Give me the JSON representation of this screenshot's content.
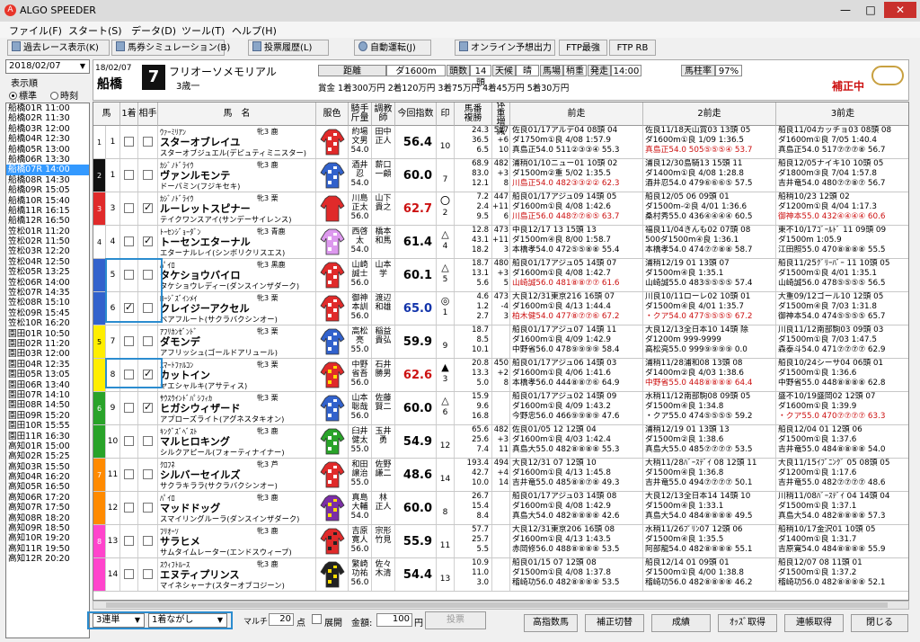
{
  "app": {
    "title": "ALGO SPEEDER",
    "logo": "A"
  },
  "menu": [
    "ファイル(F)",
    "スタート(S)",
    "データ(D)",
    "ツール(T)",
    "ヘルプ(H)"
  ],
  "toolbar": [
    "過去レース表示(K)",
    "馬券シミュレーション(B)",
    "投票履歴(L)",
    "自動運転(J)",
    "オンライン予想出力",
    "FTP最強",
    "FTP RB"
  ],
  "left": {
    "date": "2018/02/07",
    "order_label": "表示順",
    "order_options": [
      "標準",
      "時刻"
    ],
    "races": [
      "船橋01R 11:00",
      "船橋02R 11:30",
      "船橋03R 12:00",
      "船橋04R 12:30",
      "船橋05R 13:00",
      "船橋06R 13:30",
      "船橋07R 14:00",
      "船橋08R 14:30",
      "船橋09R 15:05",
      "船橋10R 15:40",
      "船橋11R 16:15",
      "船橋12R 16:50",
      "笠松01R 11:20",
      "笠松02R 11:50",
      "笠松03R 12:20",
      "笠松04R 12:50",
      "笠松05R 13:25",
      "笠松06R 14:00",
      "笠松07R 14:35",
      "笠松08R 15:10",
      "笠松09R 15:45",
      "笠松10R 16:20",
      "園田01R 10:50",
      "園田02R 11:20",
      "園田03R 12:00",
      "園田04R 12:35",
      "園田05R 13:05",
      "園田06R 13:40",
      "園田07R 14:10",
      "園田08R 14:50",
      "園田09R 15:20",
      "園田10R 15:55",
      "園田11R 16:30",
      "高知01R 15:00",
      "高知02R 15:25",
      "高知03R 15:50",
      "高知04R 16:20",
      "高知05R 16:50",
      "高知06R 17:20",
      "高知07R 17:50",
      "高知08R 18:20",
      "高知09R 18:50",
      "高知10R 19:20",
      "高知11R 19:50",
      "高知12R 20:20"
    ],
    "selected": 6
  },
  "race": {
    "date": "18/02/07",
    "venue": "船橋",
    "number": "7",
    "name": "フリオーソメモリアル",
    "cond": "3歳一",
    "labels": {
      "dist": "距離",
      "heads": "頭数",
      "weather": "天候",
      "track": "馬場",
      "start": "発走",
      "rate": "馬柱率"
    },
    "dist": "ダ1600m",
    "heads": "14頭",
    "weather": "晴",
    "track": "稍重",
    "start": "14:00",
    "rate": "97%",
    "prize": "賞金 1着300万円 2着120万円 3着75万円 4着45万円 5着30万円",
    "hosei": "補正中"
  },
  "columns": [
    "馬",
    "1着",
    "相手",
    "馬　名",
    "服色",
    "騎手\n斤量",
    "調教\n師",
    "今回指数",
    "印",
    "馬番\n複勝",
    "馬体重\n増減",
    "前走",
    "2前走",
    "3前走"
  ],
  "horses": [
    {
      "waku": "1",
      "wc": "#ffffff",
      "wt": "#000",
      "num": "1",
      "sire": "ｳｧｰﾐﾘｱﾝ",
      "sex": "牝3 鹿",
      "name": "スターオブレイユ",
      "ped": "スターオブジュエル(デピュティミニスター)",
      "silk": [
        "#e02a2a",
        "#ffffff"
      ],
      "j": [
        "約場",
        "文男",
        "54.0"
      ],
      "t": [
        "田中",
        "正人"
      ],
      "idx": "56.4",
      "ic": "",
      "mark": "",
      "m2": "10",
      "rank": [
        "24.3",
        "36.5",
        "6.5"
      ],
      "w": [
        "517",
        "+6",
        "10"
      ],
      "p1": [
        "佐良01/17アルデ04 08頭 04",
        "ダ1750m①良 4/08 1:57.9",
        "真島正54.0 511②③③④ 55.3"
      ],
      "p2": [
        "佐良11/18天山賞03 13頭 05",
        "ダ1600m①良 1/09 1:36.5",
        "真島正54.0 505⑤⑤⑤④ 53.7"
      ],
      "p3": [
        "船良11/04カッチョ03 08頭 08",
        "ダ1600m①良 7/05 1:40.4",
        "真島正54.0 517⑦⑦⑦⑧ 56.7"
      ],
      "r": [
        0,
        1,
        0
      ]
    },
    {
      "waku": "2",
      "wc": "#111111",
      "wt": "#fff",
      "num": "1",
      "sire": "ｶｼﾞﾉﾄﾞﾗｲｳ",
      "sex": "牝3 鹿",
      "name": "ヴァンルモンテ",
      "ped": "ドーバミン(フジキセキ)",
      "silk": [
        "#3262cc",
        "#ffffff"
      ],
      "j": [
        "酒井",
        "忍",
        "54.0"
      ],
      "t": [
        "薪口",
        "一顧"
      ],
      "idx": "60.0",
      "ic": "",
      "mark": "",
      "m2": "7",
      "rank": [
        "68.9",
        "83.0",
        "12.1"
      ],
      "w": [
        "482",
        "+3",
        "8"
      ],
      "p1": [
        "浦稍01/10ニュー01 10頭 02",
        "ダ1500m②重 5/02 1:35.5",
        "川島正54.0 482③③②② 62.3"
      ],
      "p2": [
        "浦良12/30島騎13 15頭 11",
        "ダ1400m①良 4/08 1:28.8",
        "酒井忍54.0 479⑥⑥⑥⑤ 57.5"
      ],
      "p3": [
        "船良12/05ナイキ10 10頭 05",
        "ダ1800m③良 7/04 1:57.8",
        "吉井竜54.0 480⑦⑦⑧⑦ 56.7"
      ],
      "r": [
        1,
        0,
        0
      ]
    },
    {
      "waku": "3",
      "wc": "#e02a2a",
      "wt": "#fff",
      "num": "3",
      "sire": "ｶｼﾞﾉﾄﾞﾗｲｳ",
      "sex": "牝3 栗",
      "name": "ルーレットスピナー",
      "ped": "テイクワンスアイ(サンデーサイレンス)",
      "silk": [
        "#e02a2a",
        "#e02a2a"
      ],
      "j": [
        "川島",
        "正太",
        "56.0"
      ],
      "t": [
        "山下",
        "貴之"
      ],
      "idx": "62.7",
      "ic": "red",
      "mark": "〇",
      "m2": "2",
      "rank": [
        "7.2",
        "2.4",
        "9.5"
      ],
      "w": [
        "447",
        "+11",
        "6"
      ],
      "p1": [
        "船良01/17アジュ09 14頭 05",
        "ダ1600m①良 4/08 1:42.6",
        "川島正56.0 448⑦⑦⑥⑤ 63.7"
      ],
      "p2": [
        "船良12/05 06 09頭 01",
        "ダ1500m-②良 4/01 1:36.6",
        "桑村秀55.0 436④④④④ 60.5"
      ],
      "p3": [
        "船稍10/23 12頭 02",
        "ダ1200m①良 4/04 1:17.3",
        "御神本55.0 432④④④④ 60.6"
      ],
      "r": [
        1,
        0,
        1
      ]
    },
    {
      "waku": "4",
      "wc": "#ffffff",
      "wt": "#000",
      "num": "4",
      "sire": "ﾄｰｾﾝｼﾞｮｰﾀﾞﾝ",
      "sex": "牝3 青鹿",
      "name": "トーセンエターナル",
      "ped": "エターナルレイ(シンボリクリスエス)",
      "silk": [
        "#dd99ee",
        "#ffffff"
      ],
      "j": [
        "西啓",
        "太",
        "54.0"
      ],
      "t": [
        "橋本",
        "和馬"
      ],
      "idx": "61.4",
      "ic": "",
      "mark": "△",
      "m2": "4",
      "rank": [
        "12.8",
        "43.1",
        "18.2"
      ],
      "w": [
        "473",
        "+11",
        "3"
      ],
      "p1": [
        "中良12/17 13 15頭 13",
        "ダ1500m④良 8/00 1:58.7",
        "本橋孝54.0 472⑤⑤⑧⑧ 55.4"
      ],
      "p2": [
        "福良11/04きんも02 07頭 08",
        "500ダ1500m④良 1:36.1",
        "本橋孝54.0 474⑦⑦⑧⑧ 58.7"
      ],
      "p3": [
        "東不10/17ｺﾞｰﾙﾄﾞ 11 09頭 09",
        "ダ1500m 1:05.9",
        "江田照55.0 470⑧⑧⑧⑧ 55.5"
      ],
      "r": [
        0,
        0,
        0
      ]
    },
    {
      "waku": "4",
      "wc": "#3262cc",
      "wt": "#fff",
      "num": "5",
      "sire": "ﾊﾟｲﾛ",
      "sex": "牝3 黒鹿",
      "name": "タケショウバイロ",
      "ped": "タケショウレディー(ダンスインザダーク)",
      "silk": [
        "#e02a2a",
        "#ffffff"
      ],
      "j": [
        "山崎",
        "誠士",
        "56.0"
      ],
      "t": [
        "山本",
        "学"
      ],
      "idx": "60.1",
      "ic": "",
      "mark": "△",
      "m2": "5",
      "rank": [
        "18.7",
        "13.1",
        "5.6"
      ],
      "w": [
        "480",
        "+3",
        "5"
      ],
      "p1": [
        "船良01/17アジュ05 14頭 07",
        "ダ1600m①良 4/08 1:42.7",
        "山崎誠56.0 481⑧⑧⑦⑦ 61.6"
      ],
      "p2": [
        "浦稍12/19 01 13頭 07",
        "ダ1500m④良 1:35.1",
        "山崎誠55.0 483⑤⑤⑤⑤ 57.4"
      ],
      "p3": [
        "船良11/25ｸﾞﾘｰﾊﾞｰ 11 10頭 05",
        "ダ1500m①良 4/01 1:35.1",
        "山崎誠56.0 478⑤⑤⑤⑤ 56.5"
      ],
      "r": [
        1,
        0,
        0
      ]
    },
    {
      "waku": "4",
      "wc": "#3262cc",
      "wt": "#fff",
      "num": "6",
      "sire": "ﾛｰｼﾞｽﾞｲﾝﾒｲ",
      "sex": "牝3 栗",
      "name": "クレイジーアクセル",
      "ped": "ベアフルート(サクラバクシンオー)",
      "silk": [
        "#e02a2a",
        "#ffffff"
      ],
      "j": [
        "御神",
        "本訓",
        "56.0"
      ],
      "t": [
        "渡辺",
        "和雄"
      ],
      "idx": "65.0",
      "ic": "blue",
      "mark": "◎",
      "m2": "1",
      "rank": [
        "4.6",
        "1.2",
        "2.7"
      ],
      "w": [
        "473",
        "-4",
        "3"
      ],
      "p1": [
        "大良12/31東京216 16頭 07",
        "ダ1600m①良 4/13 1:44.4",
        "柏木健54.0 477⑧⑦⑦⑥ 67.2"
      ],
      "p2": [
        "川良10/11ローレ02 10頭 01",
        "ダ1500m④良 4/01 1:35.7",
        "・クア54.0 477⑤⑤⑤⑤ 67.2"
      ],
      "p3": [
        "大重09/12ゴール10 12頭 05",
        "ダ1500m④良 7/03 1:31.8",
        "御神本54.0 474⑤⑤⑤⑤ 65.7"
      ],
      "r": [
        1,
        1,
        0
      ]
    },
    {
      "waku": "5",
      "wc": "#ffee00",
      "wt": "#000",
      "num": "7",
      "sire": "ｱﾌﾘｶﾝｾﾞﾝﾄﾞ",
      "sex": "牝3 栗",
      "name": "ダモンデ",
      "ped": "アフリッシュ(ゴールドアリュール)",
      "silk": [
        "#3262cc",
        "#ffffff"
      ],
      "j": [
        "高松",
        "亮",
        "55.0"
      ],
      "t": [
        "稲益",
        "貴弘"
      ],
      "idx": "59.9",
      "ic": "",
      "mark": "",
      "m2": "9",
      "rank": [
        "18.7",
        "8.5",
        "10.1"
      ],
      "w": [
        "",
        "",
        ""
      ],
      "p1": [
        "船良01/17アジュ07 14頭 11",
        "ダ1600m①良 4/09 1:42.9",
        "中野省56.0 478⑨⑨⑨⑨ 58.4"
      ],
      "p2": [
        "大良12/13全日本10 14頭 除",
        "ダ1200m 999-9999",
        "高松亮55.0 999⑨⑨⑨⑨ 0.0"
      ],
      "p3": [
        "川良11/12南部駒03 09頭 03",
        "ダ1500m①良 7/03 1:47.5",
        "森泰斗54.0 471⑦⑦⑦⑦ 62.9"
      ],
      "r": [
        0,
        0,
        0
      ]
    },
    {
      "waku": "5",
      "wc": "#ffee00",
      "wt": "#000",
      "num": "8",
      "sire": "ｽﾏｰﾄﾌｧﾙｺﾝ",
      "sex": "牝3 栗",
      "name": "カットイン",
      "ped": "ヤエシャルキ(アサティス)",
      "silk": [
        "#e02a2a",
        "#ffdd00"
      ],
      "j": [
        "中野",
        "省吾",
        "56.0"
      ],
      "t": [
        "石井",
        "勝男"
      ],
      "idx": "62.6",
      "ic": "red",
      "mark": "▲",
      "m2": "3",
      "rank": [
        "20.8",
        "13.3",
        "5.0"
      ],
      "w": [
        "450",
        "+2",
        "8"
      ],
      "p1": [
        "船良01/17アジュ06 14頭 03",
        "ダ1600m①良 4/06 1:41.6",
        "本橋孝56.0 444⑧⑧⑦⑥ 64.9"
      ],
      "p2": [
        "浦稍11/28浦和08 13頭 08",
        "ダ1400m②良 4/03 1:38.6",
        "中野省55.0 448⑧⑧⑧⑧ 64.4"
      ],
      "p3": [
        "船良10/24シーサ04 06頭 01",
        "ダ1500m①良 1:36.6",
        "中野省55.0 448⑧⑧⑧⑧ 62.8"
      ],
      "r": [
        0,
        1,
        0
      ]
    },
    {
      "waku": "6",
      "wc": "#29a329",
      "wt": "#fff",
      "num": "9",
      "sire": "ｻｳｽｳｲﾝﾄﾞﾊﾟｼﾌｨｶ",
      "sex": "牝3 栗",
      "name": "ヒガシウィザード",
      "ped": "アプローズライト(アグネスタキオン)",
      "silk": [
        "#3262cc",
        "#ffffff"
      ],
      "j": [
        "山本",
        "聡哉",
        "56.0"
      ],
      "t": [
        "佐藤",
        "賢二"
      ],
      "idx": "60.0",
      "ic": "",
      "mark": "△",
      "m2": "6",
      "rank": [
        "15.9",
        "9.6",
        "16.8"
      ],
      "w": [
        "",
        "",
        ""
      ],
      "p1": [
        "船良01/17アジュ02 14頭 09",
        "ダ1600m①良 4/09 1:43.2",
        "今野忠56.0 466⑨⑨⑧⑨ 47.6"
      ],
      "p2": [
        "水稍11/12南部駒08 09頭 05",
        "ダ1500m④良 1:34.8",
        "・クア55.0 474⑤⑤⑤⑤ 59.2"
      ],
      "p3": [
        "盛不10/19盛岡02 12頭 07",
        "ダ1600m①良 1:39.9",
        "・クア55.0 470⑦⑦⑦⑦ 63.3"
      ],
      "r": [
        0,
        0,
        1
      ]
    },
    {
      "waku": "6",
      "wc": "#29a329",
      "wt": "#fff",
      "num": "10",
      "sire": "ｷﾝｸﾞｽﾞﾍﾞｽﾄ",
      "sex": "牝3 鹿",
      "name": "マルヒロキング",
      "ped": "シルクアピール(フォーティナイナー)",
      "silk": [
        "#29a329",
        "#ffffff"
      ],
      "j": [
        "臼井",
        "健太",
        "55.0"
      ],
      "t": [
        "玉井",
        "勇"
      ],
      "idx": "54.9",
      "ic": "",
      "mark": "",
      "m2": "12",
      "rank": [
        "65.6",
        "25.6",
        "7.4"
      ],
      "w": [
        "482",
        "+3",
        "11"
      ],
      "p1": [
        "佐良01/05 12 12頭 04",
        "ダ1600m①良 4/03 1:42.4",
        "真島大55.0 482⑧⑧⑧⑧ 55.3"
      ],
      "p2": [
        "浦稍12/19 01 13頭 13",
        "ダ1500m②良 1:38.6",
        "真島大55.0 485⑦⑦⑦⑦ 53.5"
      ],
      "p3": [
        "船良12/04 01 12頭 06",
        "ダ1500m①良 1:37.6",
        "吉井竜55.0 484⑧⑧⑧⑧ 54.0"
      ],
      "r": [
        0,
        0,
        0
      ]
    },
    {
      "waku": "7",
      "wc": "#ff8a00",
      "wt": "#fff",
      "num": "11",
      "sire": "ｸﾛﾌﾈ",
      "sex": "牝3 芦",
      "name": "シルバーセイルズ",
      "ped": "サクラキララ(サクラバクシンオー)",
      "silk": [
        "#e02a2a",
        "#ffffff"
      ],
      "j": [
        "和田",
        "譲治",
        "55.0"
      ],
      "t": [
        "佐野",
        "謙二"
      ],
      "idx": "48.6",
      "ic": "",
      "mark": "",
      "m2": "14",
      "rank": [
        "193.4",
        "42.7",
        "10.0"
      ],
      "w": [
        "494",
        "+4",
        "14"
      ],
      "p1": [
        "大良12/31 07 12頭 10",
        "ダ1600m①良 4/13 1:45.8",
        "吉井竜55.0 485⑧⑧⑦⑧ 49.3"
      ],
      "p2": [
        "大稍11/28ﾊﾞｰｽﾃﾞｲ 08 12頭 11",
        "ダ1500m④良 1:36.8",
        "吉井竜55.0 494⑦⑦⑦⑦ 50.1"
      ],
      "p3": [
        "大良11/15ｲﾌﾞﾆﾝｸﾞ 05 08頭 05",
        "ダ1200m①良 1:17.6",
        "吉井竜55.0 482⑦⑦⑦⑦ 48.6"
      ],
      "r": [
        0,
        0,
        0
      ]
    },
    {
      "waku": "7",
      "wc": "#ff8a00",
      "wt": "#fff",
      "num": "12",
      "sire": "ﾊﾟｲﾛ",
      "sex": "牝3 鹿",
      "name": "マッドドッグ",
      "ped": "スマイリングルーラ(ダンスインザダーク)",
      "silk": [
        "#7b2ea6",
        "#ffdd00"
      ],
      "j": [
        "真島",
        "大輔",
        "54.0"
      ],
      "t": [
        "林",
        "正人"
      ],
      "idx": "60.0",
      "ic": "",
      "mark": "",
      "m2": "8",
      "rank": [
        "26.7",
        "15.4",
        "8.4"
      ],
      "w": [
        "",
        "",
        ""
      ],
      "p1": [
        "船良01/17アジュ03 14頭 08",
        "ダ1600m①良 4/08 1:42.9",
        "真島大54.0 482⑧⑧⑧⑧ 42.6"
      ],
      "p2": [
        "大良12/13全日本14 14頭 10",
        "ダ1500m④良 1:33.1",
        "真島大54.0 484⑧⑧⑧⑧ 49.5"
      ],
      "p3": [
        "川稍11/08ﾊﾞｰｽﾃﾞｲ 04 14頭 04",
        "ダ1500m①良 1:37.1",
        "真島大54.0 482⑧⑧⑧⑧ 57.3"
      ],
      "r": [
        0,
        0,
        0
      ]
    },
    {
      "waku": "8",
      "wc": "#ff44cc",
      "wt": "#fff",
      "num": "13",
      "sire": "ﾌﾘｵｰｿ",
      "sex": "牝3 鹿",
      "name": "サラヒメ",
      "ped": "サムタイムレーター(エンドスウィープ)",
      "silk": [
        "#e02a2a",
        "#222222"
      ],
      "j": [
        "吉原",
        "寛人",
        "56.0"
      ],
      "t": [
        "宗形",
        "竹見"
      ],
      "idx": "55.9",
      "ic": "",
      "mark": "",
      "m2": "11",
      "rank": [
        "57.7",
        "25.7",
        "5.5"
      ],
      "w": [
        "",
        "",
        ""
      ],
      "p1": [
        "大良12/31東京206 16頭 08",
        "ダ1600m①良 4/13 1:43.5",
        "赤岡修56.0 488⑧⑧⑧⑧ 53.5"
      ],
      "p2": [
        "水稍11/26ﾌﾟﾘﾝ07 12頭 06",
        "ダ1500m④良 1:35.5",
        "阿部龍54.0 482⑧⑧⑧⑧ 55.1"
      ],
      "p3": [
        "船稍10/17金沢01 10頭 05",
        "ダ1400m①良 1:31.7",
        "吉原寛54.0 484⑧⑧⑧⑧ 55.9"
      ],
      "r": [
        0,
        0,
        0
      ]
    },
    {
      "waku": "8",
      "wc": "#ff44cc",
      "wt": "#fff",
      "num": "14",
      "sire": "ｽｳｨﾌﾄﾙｰｽ",
      "sex": "牝3 鹿",
      "name": "エヌティプリンス",
      "ped": "マイネシャーナ(スターオブコジーン)",
      "silk": [
        "#222222",
        "#ffdd00"
      ],
      "j": [
        "繁崎",
        "功祐",
        "56.0"
      ],
      "t": [
        "佐々",
        "木清"
      ],
      "idx": "54.4",
      "ic": "",
      "mark": "",
      "m2": "13",
      "rank": [
        "10.9",
        "11.0",
        "3.0"
      ],
      "w": [
        "",
        "",
        ""
      ],
      "p1": [
        "船良01/15 07 12頭 08",
        "ダ1500m①良 4/08 1:37.8",
        "稽崎功56.0 482⑧⑧⑧⑧ 53.5"
      ],
      "p2": [
        "船良12/14 01 09頭 01",
        "ダ1500m①良 4/00 1:38.8",
        "稽崎功56.0 482⑧⑧⑧⑧ 46.2"
      ],
      "p3": [
        "船良12/07 08 11頭 01",
        "ダ1500m①良 1:37.2",
        "稽崎功56.0 482⑧⑧⑧⑧ 52.1"
      ],
      "r": [
        0,
        0,
        0
      ]
    }
  ],
  "checks": {
    "first": [
      0,
      0,
      0,
      0,
      0,
      1,
      0,
      0,
      0,
      0,
      0,
      0,
      0,
      0
    ],
    "aite": [
      0,
      0,
      1,
      1,
      0,
      0,
      0,
      1,
      1,
      0,
      0,
      0,
      0,
      0
    ]
  },
  "bottom": {
    "bet_type": "3連単",
    "mode": "1着ながし",
    "multi": "マルチ",
    "points": "20",
    "points_unit": "点",
    "spread": "展開",
    "amount_label": "金額:",
    "amount": "100",
    "yen": "円",
    "vote": "投票",
    "buttons": [
      "高指数馬",
      "補正切替",
      "成績",
      "ｵｯｽﾞ取得",
      "連帳取得",
      "閉じる"
    ]
  }
}
